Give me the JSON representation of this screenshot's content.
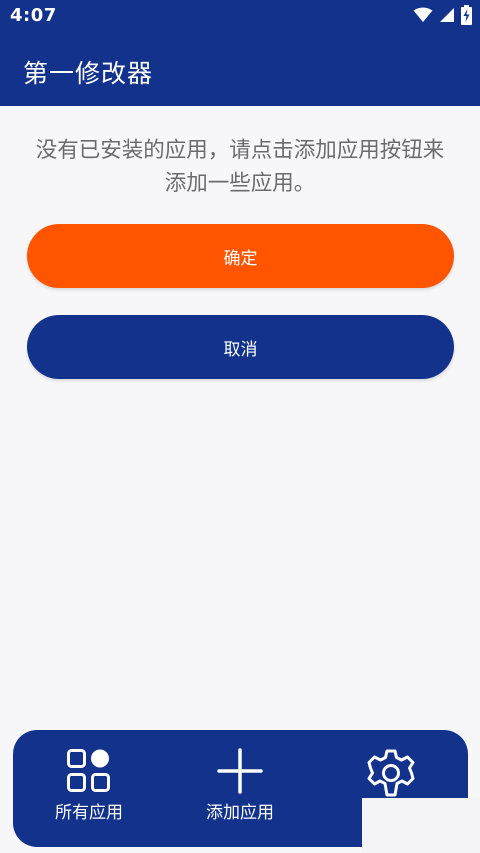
{
  "status_bar": {
    "time": "4:07",
    "icons": [
      "wifi-icon",
      "signal-icon",
      "battery-charging-icon"
    ]
  },
  "header": {
    "title": "第一修改器",
    "background_color": "#12328c"
  },
  "main": {
    "empty_message": "没有已安装的应用，请点击添加应用按钮来添加一些应用。",
    "confirm_button": {
      "label": "确定",
      "color": "#ff5500"
    },
    "cancel_button": {
      "label": "取消",
      "color": "#12328c"
    }
  },
  "bottom_nav": {
    "items": [
      {
        "label": "所有应用",
        "icon": "grid-apps-icon"
      },
      {
        "label": "添加应用",
        "icon": "plus-icon"
      },
      {
        "label": "",
        "icon": "gear-icon"
      }
    ]
  }
}
